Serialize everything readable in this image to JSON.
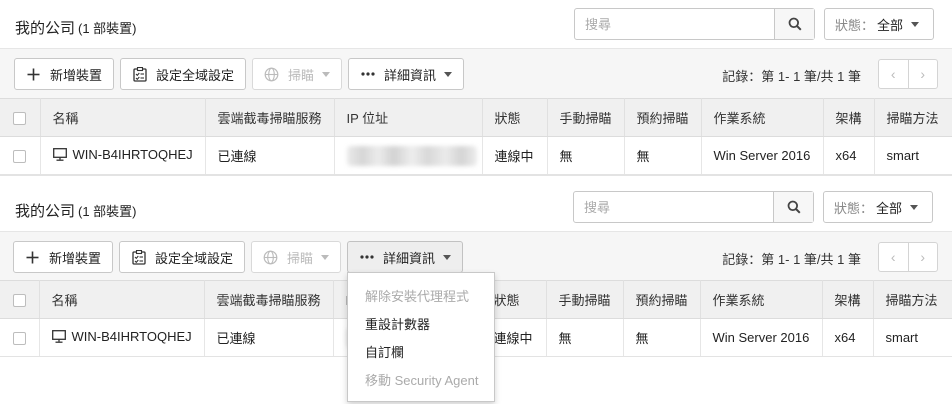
{
  "company": {
    "title": "我的公司",
    "count": "(1 部裝置)"
  },
  "search": {
    "placeholder": "搜尋"
  },
  "status_filter": {
    "label": "狀態：",
    "value": "全部"
  },
  "toolbar": {
    "add_device": "新增裝置",
    "global_settings": "設定全域設定",
    "scan": "掃瞄",
    "details": "詳細資訊"
  },
  "pagination": {
    "records": "記錄：第 1- 1 筆/共 1 筆",
    "prev": "‹",
    "next": "›"
  },
  "table": {
    "headers": [
      "名稱",
      "雲端截毒掃瞄服務",
      "IP 位址",
      "狀態",
      "手動掃瞄",
      "預約掃瞄",
      "作業系統",
      "架構",
      "掃瞄方法"
    ],
    "rows": [
      {
        "name": "WIN-B4IHRTOQHEJ",
        "cloud_service": "已連線",
        "ip": "",
        "status": "連線中",
        "manual_scan": "無",
        "scheduled_scan": "無",
        "os": "Win Server 2016",
        "arch": "x64",
        "scan_method": "smart"
      }
    ]
  },
  "details_menu": {
    "items": [
      {
        "label": "解除安裝代理程式",
        "disabled": true
      },
      {
        "label": "重設計數器",
        "disabled": false
      },
      {
        "label": "自訂欄",
        "disabled": false
      },
      {
        "label": "移動 Security Agent",
        "disabled": true
      }
    ]
  },
  "icons": {
    "search": "search-icon",
    "add": "plus-icon",
    "settings": "checklist-icon",
    "scan": "globe-icon",
    "details": "more-dots-icon",
    "endpoint": "monitor-icon"
  }
}
